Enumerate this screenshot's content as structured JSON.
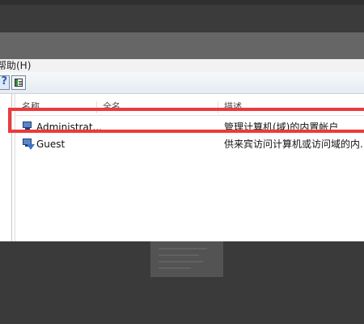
{
  "menubar": {
    "help_label": "帮助(H)"
  },
  "toolbar": {
    "help_icon": "help-icon",
    "show_hide_pane_icon": "panel-icon"
  },
  "list": {
    "columns": [
      "名称",
      "全名",
      "描述"
    ],
    "rows": [
      {
        "name": "Administrat...",
        "full_name": "",
        "description": "管理计算机(域)的内置帐户",
        "icon": "user-icon"
      },
      {
        "name": "Guest",
        "full_name": "",
        "description": "供来宾访问计算机或访问域的内...",
        "icon": "user-download-icon"
      }
    ]
  },
  "colors": {
    "highlight": "#ec3a3a",
    "window_bg": "#ffffff",
    "toolbar_bg": "#eaf1fb"
  }
}
